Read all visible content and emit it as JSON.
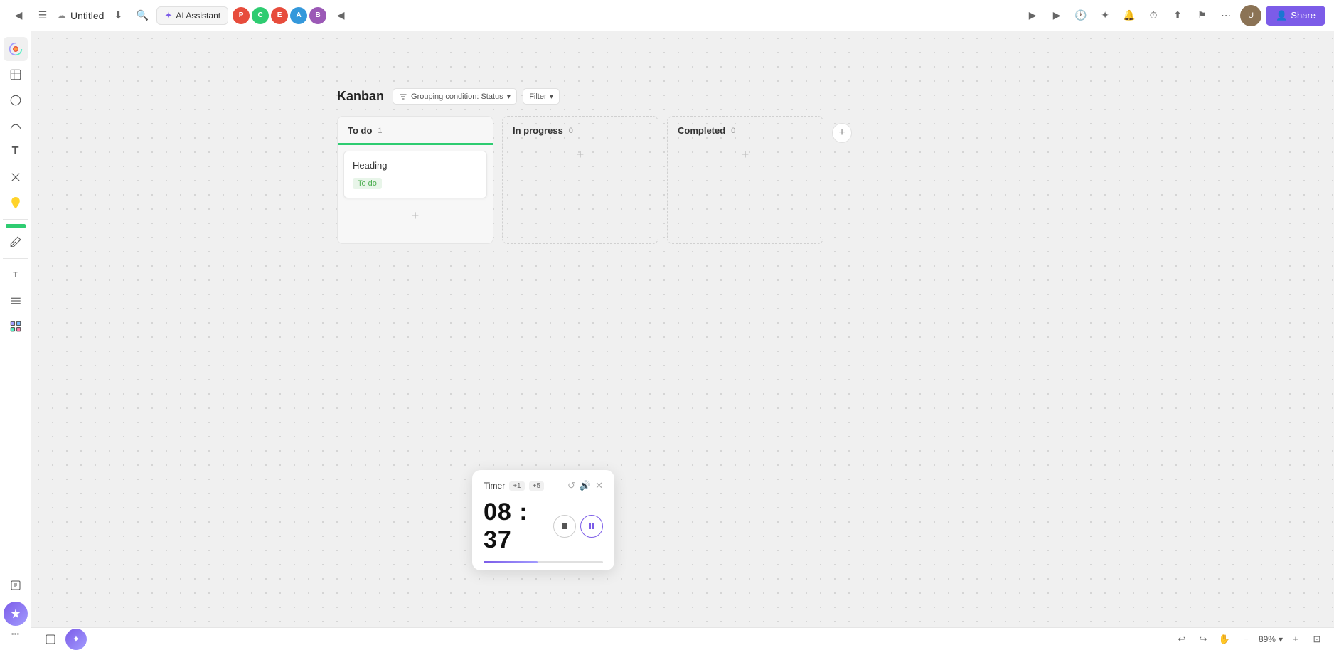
{
  "topbar": {
    "title": "Untitled",
    "ai_assistant_label": "AI Assistant",
    "share_label": "Share",
    "back_icon": "◀",
    "menu_icon": "☰",
    "cloud_icon": "☁",
    "download_icon": "⬇",
    "search_icon": "🔍",
    "collapse_icon": "◀"
  },
  "kanban": {
    "title": "Kanban",
    "grouping_label": "Grouping condition: Status",
    "filter_label": "Filter",
    "columns": [
      {
        "id": "todo",
        "title": "To do",
        "count": 1,
        "color": "#2ecc71",
        "cards": [
          {
            "title": "Heading",
            "tag": "To do"
          }
        ]
      },
      {
        "id": "inprogress",
        "title": "In progress",
        "count": 0,
        "color": "#e5e5e5",
        "cards": []
      },
      {
        "id": "completed",
        "title": "Completed",
        "count": 0,
        "color": "#e5e5e5",
        "cards": []
      }
    ],
    "add_column_icon": "+"
  },
  "timer": {
    "label": "Timer",
    "badge1": "+1",
    "badge2": "+5",
    "time": "08 : 37",
    "stop_icon": "⏹",
    "pause_icon": "⏸",
    "progress_percent": 45
  },
  "sidebar": {
    "items": [
      {
        "icon": "◈",
        "name": "palette"
      },
      {
        "icon": "⬜",
        "name": "frame"
      },
      {
        "icon": "◯",
        "name": "shape"
      },
      {
        "icon": "〜",
        "name": "curve"
      },
      {
        "icon": "T",
        "name": "text"
      },
      {
        "icon": "✕",
        "name": "connector"
      },
      {
        "icon": "◕",
        "name": "sticky"
      },
      {
        "icon": "✏",
        "name": "pen"
      }
    ],
    "bottom_items": [
      {
        "icon": "⊞",
        "name": "pages"
      },
      {
        "icon": "✦",
        "name": "ai"
      }
    ]
  },
  "bottombar": {
    "undo_icon": "↩",
    "redo_icon": "↪",
    "hand_icon": "✋",
    "zoom_minus_icon": "−",
    "zoom_level": "89%",
    "zoom_plus_icon": "+",
    "fit_icon": "⊡"
  }
}
